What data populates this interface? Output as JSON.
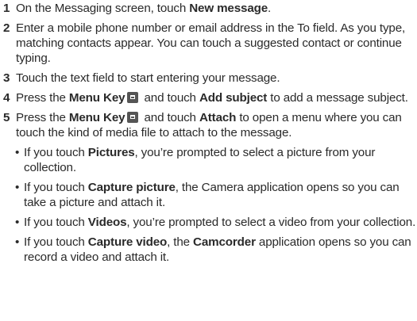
{
  "steps": [
    {
      "num": "1",
      "t1": "On the Messaging screen, touch ",
      "b1": "New message",
      "t2": "."
    },
    {
      "num": "2",
      "t1": "Enter a mobile phone number or email address in the To field. As you type, matching contacts appear. You can touch a suggested contact or continue typing."
    },
    {
      "num": "3",
      "t1": "Touch the text field to start entering your message."
    },
    {
      "num": "4",
      "t1": "Press the ",
      "b1": "Menu Key",
      "t2": " and touch ",
      "b2": "Add subject",
      "t3": " to add a message subject."
    },
    {
      "num": "5",
      "t1": "Press the ",
      "b1": "Menu Key",
      "t2": " and touch ",
      "b2": "Attach",
      "t3": " to open a menu where you can touch the kind of media file to attach to the message."
    }
  ],
  "bullet_char": "•",
  "bullets": [
    {
      "t1": "If you touch ",
      "b1": "Pictures",
      "t2": ", you’re prompted to select a picture from your collection."
    },
    {
      "t1": "If you touch ",
      "b1": "Capture picture",
      "t2": ", the Camera application opens so you can take a picture and attach it."
    },
    {
      "t1": "If you touch ",
      "b1": "Videos",
      "t2": ", you’re prompted to select a video from your collection."
    },
    {
      "t1": "If you touch ",
      "b1": "Capture video",
      "t2": ", the ",
      "b2": "Camcorder",
      "t3": " application opens so you can record a video and attach it."
    }
  ],
  "icon": {
    "menu_key": "menu-key-icon"
  }
}
